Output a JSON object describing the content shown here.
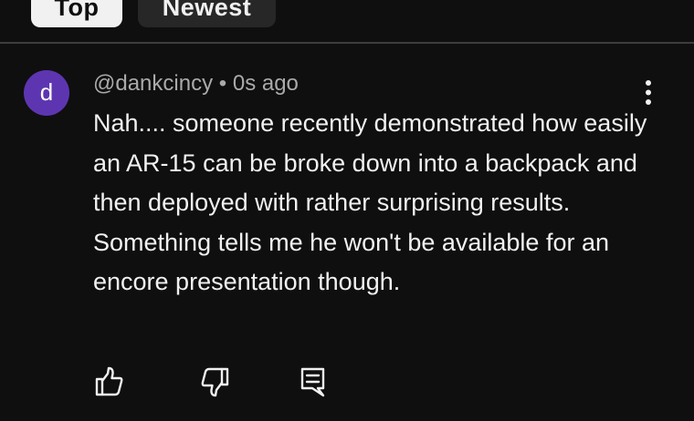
{
  "filters": {
    "top_label": "Top",
    "newest_label": "Newest"
  },
  "comment": {
    "avatar_letter": "d",
    "author": "@dankcincy",
    "separator": " • ",
    "time": "0s ago",
    "text": "Nah.... someone recently demonstrated how easily an AR-15 can be broke down into a backpack and then deployed with rather surprising results.\n Something tells me he won't be available for an encore presentation though."
  },
  "icons": {
    "more": "more-vert-icon",
    "like": "thumbs-up-icon",
    "dislike": "thumbs-down-icon",
    "reply": "comment-reply-icon"
  },
  "colors": {
    "background": "#0f0f0f",
    "avatar": "#5e35b1",
    "text": "#f1f1f1",
    "meta": "#aaaaaa"
  }
}
